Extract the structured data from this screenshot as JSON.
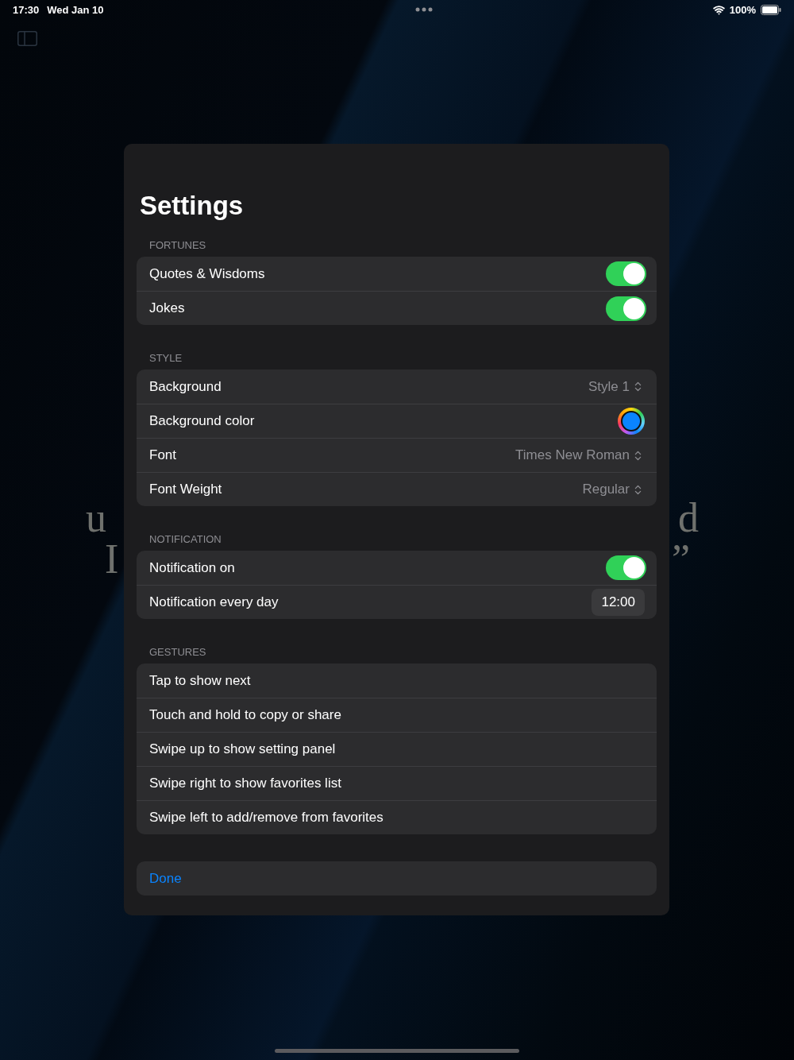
{
  "status_bar": {
    "time": "17:30",
    "date": "Wed Jan 10",
    "battery": "100%"
  },
  "background_quote": {
    "left_lines": [
      "u",
      "I"
    ],
    "right_lines": [
      "d",
      "”"
    ]
  },
  "sheet": {
    "title": "Settings",
    "sections": [
      {
        "header": "FORTUNES",
        "rows": [
          {
            "kind": "toggle",
            "label": "Quotes & Wisdoms",
            "on": true
          },
          {
            "kind": "toggle",
            "label": "Jokes",
            "on": true
          }
        ]
      },
      {
        "header": "STYLE",
        "rows": [
          {
            "kind": "picker",
            "label": "Background",
            "value": "Style 1"
          },
          {
            "kind": "color",
            "label": "Background color",
            "color": "#0a84ff"
          },
          {
            "kind": "picker",
            "label": "Font",
            "value": "Times New Roman"
          },
          {
            "kind": "picker",
            "label": "Font Weight",
            "value": "Regular"
          }
        ]
      },
      {
        "header": "NOTIFICATION",
        "rows": [
          {
            "kind": "toggle",
            "label": "Notification on",
            "on": true
          },
          {
            "kind": "time",
            "label": "Notification every day",
            "value": "12:00"
          }
        ]
      },
      {
        "header": "GESTURES",
        "rows": [
          {
            "kind": "plain",
            "label": "Tap to show next"
          },
          {
            "kind": "plain",
            "label": "Touch and hold to copy or share"
          },
          {
            "kind": "plain",
            "label": "Swipe up to show setting panel"
          },
          {
            "kind": "plain",
            "label": "Swipe right to show favorites list"
          },
          {
            "kind": "plain",
            "label": "Swipe left to add/remove from favorites"
          }
        ]
      }
    ],
    "done_button": "Done"
  }
}
